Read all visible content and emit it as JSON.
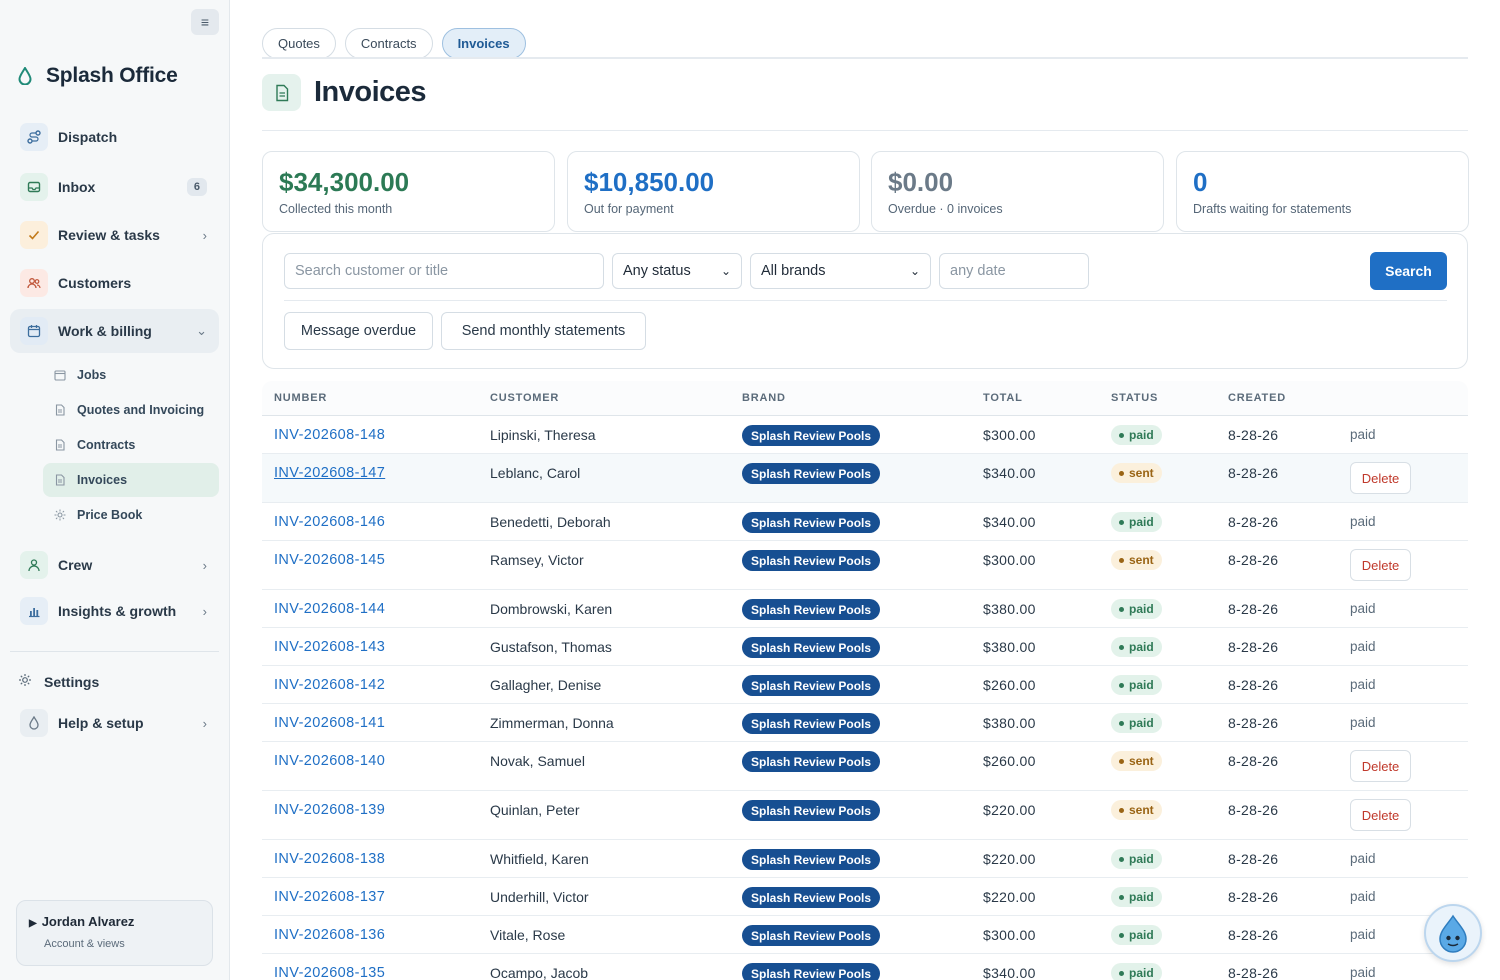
{
  "sidebar": {
    "brand_name": "Splash Office",
    "nav": [
      {
        "label": "Dispatch"
      },
      {
        "label": "Inbox",
        "badge": "6"
      },
      {
        "label": "Review & tasks"
      },
      {
        "label": "Customers"
      },
      {
        "label": "Work & billing"
      }
    ],
    "sub": [
      {
        "label": "Jobs"
      },
      {
        "label": "Quotes and Invoicing"
      },
      {
        "label": "Contracts"
      },
      {
        "label": "Invoices"
      },
      {
        "label": "Price Book"
      }
    ],
    "nav2": [
      {
        "label": "Crew"
      },
      {
        "label": "Insights & growth"
      }
    ],
    "settings_label": "Settings",
    "help_label": "Help & setup",
    "account": {
      "name": "Jordan Alvarez",
      "sub": "Account & views"
    }
  },
  "tabs": [
    {
      "label": "Quotes"
    },
    {
      "label": "Contracts"
    },
    {
      "label": "Invoices"
    }
  ],
  "page_title": "Invoices",
  "stats": [
    {
      "value": "$34,300.00",
      "label": "Collected this month",
      "color": "#2c7a55"
    },
    {
      "value": "$10,850.00",
      "label": "Out for payment",
      "color": "#1f6fc5"
    },
    {
      "value": "$0.00",
      "label": "Overdue · 0 invoices",
      "color": "#6b7a88"
    },
    {
      "value": "0",
      "label": "Drafts waiting for statements",
      "color": "#1f6fc5"
    }
  ],
  "filters": {
    "search_placeholder": "Search customer or title",
    "status_value": "Any status",
    "brand_value": "All brands",
    "date_placeholder": "any date",
    "search_button": "Search",
    "message_overdue": "Message overdue",
    "send_statements": "Send monthly statements"
  },
  "table": {
    "headers": {
      "number": "NUMBER",
      "customer": "CUSTOMER",
      "brand": "BRAND",
      "total": "TOTAL",
      "status": "STATUS",
      "created": "CREATED"
    },
    "delete_label": "Delete",
    "rows": [
      {
        "number": "INV-202608-148",
        "customer": "Lipinski, Theresa",
        "brand": "Splash Review Pools",
        "total": "$300.00",
        "status": "paid",
        "created": "8-28-26",
        "action": "paid"
      },
      {
        "number": "INV-202608-147",
        "customer": "Leblanc, Carol",
        "brand": "Splash Review Pools",
        "total": "$340.00",
        "status": "sent",
        "created": "8-28-26",
        "action": "Delete"
      },
      {
        "number": "INV-202608-146",
        "customer": "Benedetti, Deborah",
        "brand": "Splash Review Pools",
        "total": "$340.00",
        "status": "paid",
        "created": "8-28-26",
        "action": "paid"
      },
      {
        "number": "INV-202608-145",
        "customer": "Ramsey, Victor",
        "brand": "Splash Review Pools",
        "total": "$300.00",
        "status": "sent",
        "created": "8-28-26",
        "action": "Delete"
      },
      {
        "number": "INV-202608-144",
        "customer": "Dombrowski, Karen",
        "brand": "Splash Review Pools",
        "total": "$380.00",
        "status": "paid",
        "created": "8-28-26",
        "action": "paid"
      },
      {
        "number": "INV-202608-143",
        "customer": "Gustafson, Thomas",
        "brand": "Splash Review Pools",
        "total": "$380.00",
        "status": "paid",
        "created": "8-28-26",
        "action": "paid"
      },
      {
        "number": "INV-202608-142",
        "customer": "Gallagher, Denise",
        "brand": "Splash Review Pools",
        "total": "$260.00",
        "status": "paid",
        "created": "8-28-26",
        "action": "paid"
      },
      {
        "number": "INV-202608-141",
        "customer": "Zimmerman, Donna",
        "brand": "Splash Review Pools",
        "total": "$380.00",
        "status": "paid",
        "created": "8-28-26",
        "action": "paid"
      },
      {
        "number": "INV-202608-140",
        "customer": "Novak, Samuel",
        "brand": "Splash Review Pools",
        "total": "$260.00",
        "status": "sent",
        "created": "8-28-26",
        "action": "Delete"
      },
      {
        "number": "INV-202608-139",
        "customer": "Quinlan, Peter",
        "brand": "Splash Review Pools",
        "total": "$220.00",
        "status": "sent",
        "created": "8-28-26",
        "action": "Delete"
      },
      {
        "number": "INV-202608-138",
        "customer": "Whitfield, Karen",
        "brand": "Splash Review Pools",
        "total": "$220.00",
        "status": "paid",
        "created": "8-28-26",
        "action": "paid"
      },
      {
        "number": "INV-202608-137",
        "customer": "Underhill, Victor",
        "brand": "Splash Review Pools",
        "total": "$220.00",
        "status": "paid",
        "created": "8-28-26",
        "action": "paid"
      },
      {
        "number": "INV-202608-136",
        "customer": "Vitale, Rose",
        "brand": "Splash Review Pools",
        "total": "$300.00",
        "status": "paid",
        "created": "8-28-26",
        "action": "paid"
      },
      {
        "number": "INV-202608-135",
        "customer": "Ocampo, Jacob",
        "brand": "Splash Review Pools",
        "total": "$340.00",
        "status": "paid",
        "created": "8-28-26",
        "action": "paid"
      }
    ]
  }
}
